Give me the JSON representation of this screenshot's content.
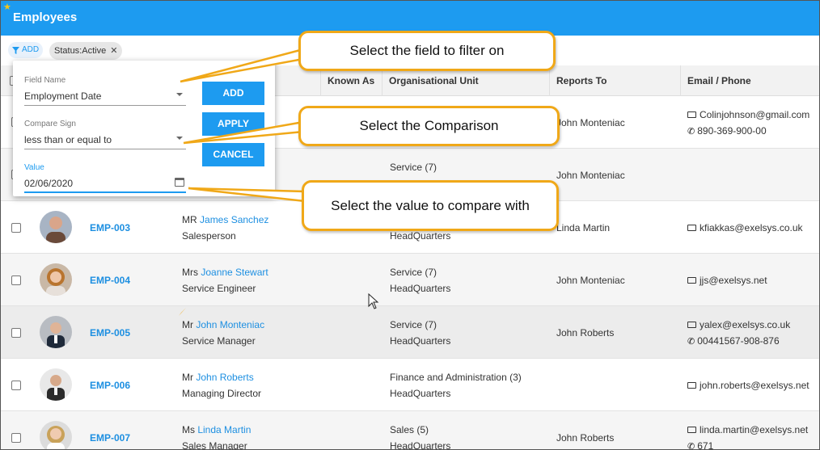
{
  "app": {
    "title": "Employees"
  },
  "toolbar": {
    "add_label": "ADD",
    "chip_label": "Status:Active"
  },
  "columns": [
    "Known As",
    "Organisational Unit",
    "Reports To",
    "Email / Phone"
  ],
  "filter_panel": {
    "field_name_label": "Field Name",
    "field_name_value": "Employment Date",
    "compare_label": "Compare Sign",
    "compare_value": "less than or equal to",
    "value_label": "Value",
    "value_value": "02/06/2020",
    "add_button": "ADD",
    "apply_button": "APPLY",
    "cancel_button": "CANCEL"
  },
  "callouts": {
    "field": "Select the field to filter on",
    "comparison": "Select the Comparison",
    "value": "Select the value to compare with"
  },
  "rows": [
    {
      "id": "",
      "title": "",
      "name": "",
      "role": "",
      "ou": "",
      "ou2": "",
      "reports_to": "John Monteniac",
      "email": "Colinjohnson@gmail.com",
      "phone": "890-369-900-00"
    },
    {
      "id": "",
      "title": "",
      "name": "",
      "role": "",
      "ou": "Service (7)",
      "ou2": "",
      "reports_to": "John Monteniac",
      "email": "",
      "phone": ""
    },
    {
      "id": "EMP-003",
      "title": "MR",
      "name": "James Sanchez",
      "role": "Salesperson",
      "ou": "",
      "ou2": "HeadQuarters",
      "reports_to": "Linda Martin",
      "email": "kfiakkas@exelsys.co.uk",
      "phone": ""
    },
    {
      "id": "EMP-004",
      "title": "Mrs",
      "name": "Joanne Stewart",
      "role": "Service Engineer",
      "ou": "Service (7)",
      "ou2": "HeadQuarters",
      "reports_to": "John Monteniac",
      "email": "jjs@exelsys.net",
      "phone": ""
    },
    {
      "id": "EMP-005",
      "title": "Mr",
      "name": "John Monteniac",
      "role": "Service Manager",
      "ou": "Service (7)",
      "ou2": "HeadQuarters",
      "reports_to": "John Roberts",
      "email": "yalex@exelsys.co.uk",
      "phone": "00441567-908-876"
    },
    {
      "id": "EMP-006",
      "title": "Mr",
      "name": "John Roberts",
      "role": "Managing Director",
      "ou": "Finance and Administration (3)",
      "ou2": "HeadQuarters",
      "reports_to": "",
      "email": "john.roberts@exelsys.net",
      "phone": ""
    },
    {
      "id": "EMP-007",
      "title": "Ms",
      "name": "Linda Martin",
      "role": "Sales Manager",
      "ou": "Sales (5)",
      "ou2": "HeadQuarters",
      "reports_to": "John Roberts",
      "email": "linda.martin@exelsys.net",
      "phone": "671"
    }
  ],
  "colors": {
    "accent": "#1d9bf0",
    "callout_border": "#f0a818"
  }
}
